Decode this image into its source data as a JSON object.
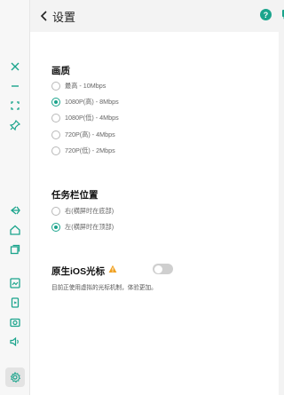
{
  "header": {
    "title": "设置"
  },
  "quality": {
    "title": "画质",
    "options": [
      {
        "label": "最高 - 10Mbps",
        "checked": false
      },
      {
        "label": "1080P(高) - 8Mbps",
        "checked": true
      },
      {
        "label": "1080P(低)  - 4Mbps",
        "checked": false
      },
      {
        "label": "720P(高)  - 4Mbps",
        "checked": false
      },
      {
        "label": "720P(低)  - 2Mbps",
        "checked": false
      }
    ]
  },
  "taskbar": {
    "title": "任务栏位置",
    "options": [
      {
        "label": "右(横屏时在底部)",
        "checked": false
      },
      {
        "label": "左(横屏时在顶部)",
        "checked": true
      }
    ]
  },
  "cursor": {
    "title": "原生iOS光标",
    "enabled": false,
    "description": "目前正使用虚拟的光标机制，体验更加。"
  },
  "colors": {
    "accent": "#1aa48c",
    "warning": "#f0a020"
  },
  "toolbar_icons": [
    "close-icon",
    "minimize-icon",
    "fullscreen-icon",
    "pin-icon",
    "back-icon",
    "home-icon",
    "recents-icon",
    "screenshot-icon",
    "rotate-icon",
    "camera-icon",
    "volume-icon",
    "settings-icon"
  ]
}
